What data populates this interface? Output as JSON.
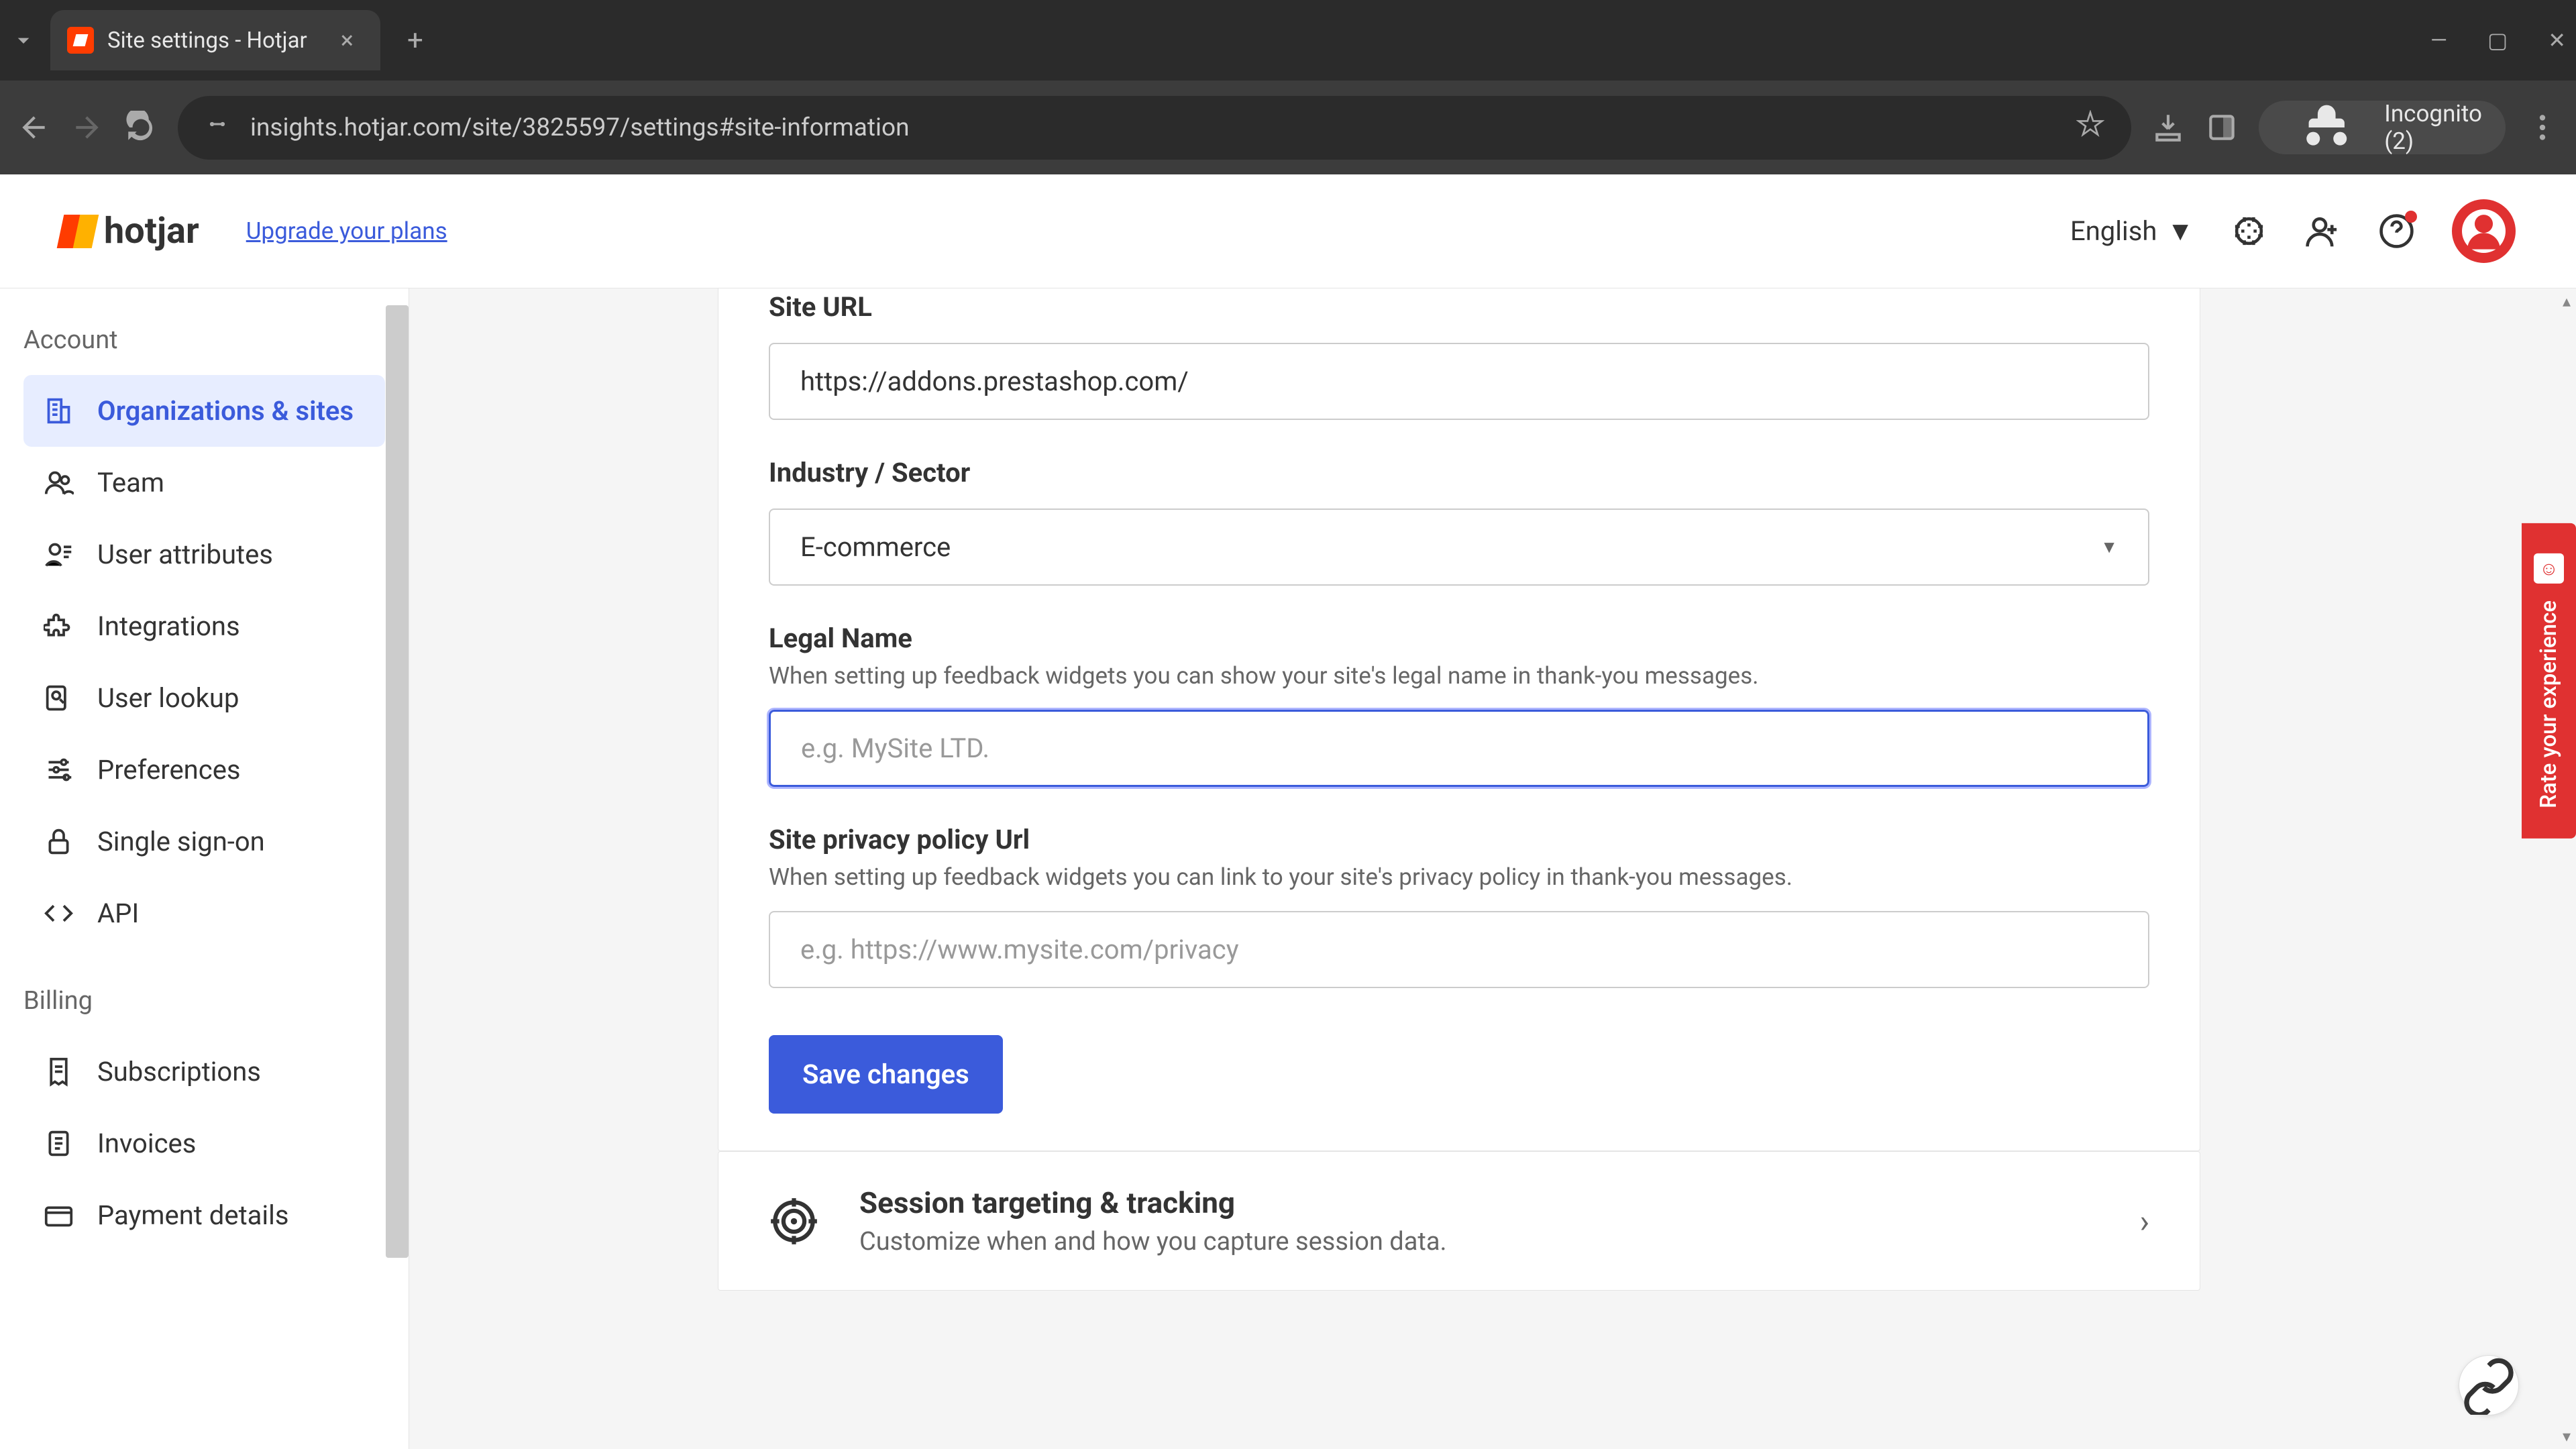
{
  "browser": {
    "tab_title": "Site settings - Hotjar",
    "url": "insights.hotjar.com/site/3825597/settings#site-information",
    "incognito_label": "Incognito (2)"
  },
  "header": {
    "logo_text": "hotjar",
    "upgrade_link": "Upgrade your plans",
    "language": "English"
  },
  "sidebar": {
    "account_heading": "Account",
    "account_items": [
      {
        "label": "Organizations & sites",
        "active": true
      },
      {
        "label": "Team"
      },
      {
        "label": "User attributes"
      },
      {
        "label": "Integrations"
      },
      {
        "label": "User lookup"
      },
      {
        "label": "Preferences"
      },
      {
        "label": "Single sign-on"
      },
      {
        "label": "API"
      }
    ],
    "billing_heading": "Billing",
    "billing_items": [
      {
        "label": "Subscriptions"
      },
      {
        "label": "Invoices"
      },
      {
        "label": "Payment details"
      }
    ]
  },
  "form": {
    "site_url_label": "Site URL",
    "site_url_value": "https://addons.prestashop.com/",
    "industry_label": "Industry / Sector",
    "industry_value": "E-commerce",
    "legal_name_label": "Legal Name",
    "legal_name_sublabel": "When setting up feedback widgets you can show your site's legal name in thank-you messages.",
    "legal_name_placeholder": "e.g. MySite LTD.",
    "legal_name_value": "",
    "privacy_label": "Site privacy policy Url",
    "privacy_sublabel": "When setting up feedback widgets you can link to your site's privacy policy in thank-you messages.",
    "privacy_placeholder": "e.g. https://www.mysite.com/privacy",
    "privacy_value": "",
    "save_button": "Save changes"
  },
  "session_section": {
    "title": "Session targeting & tracking",
    "desc": "Customize when and how you capture session data."
  },
  "feedback": {
    "label": "Rate your experience"
  }
}
